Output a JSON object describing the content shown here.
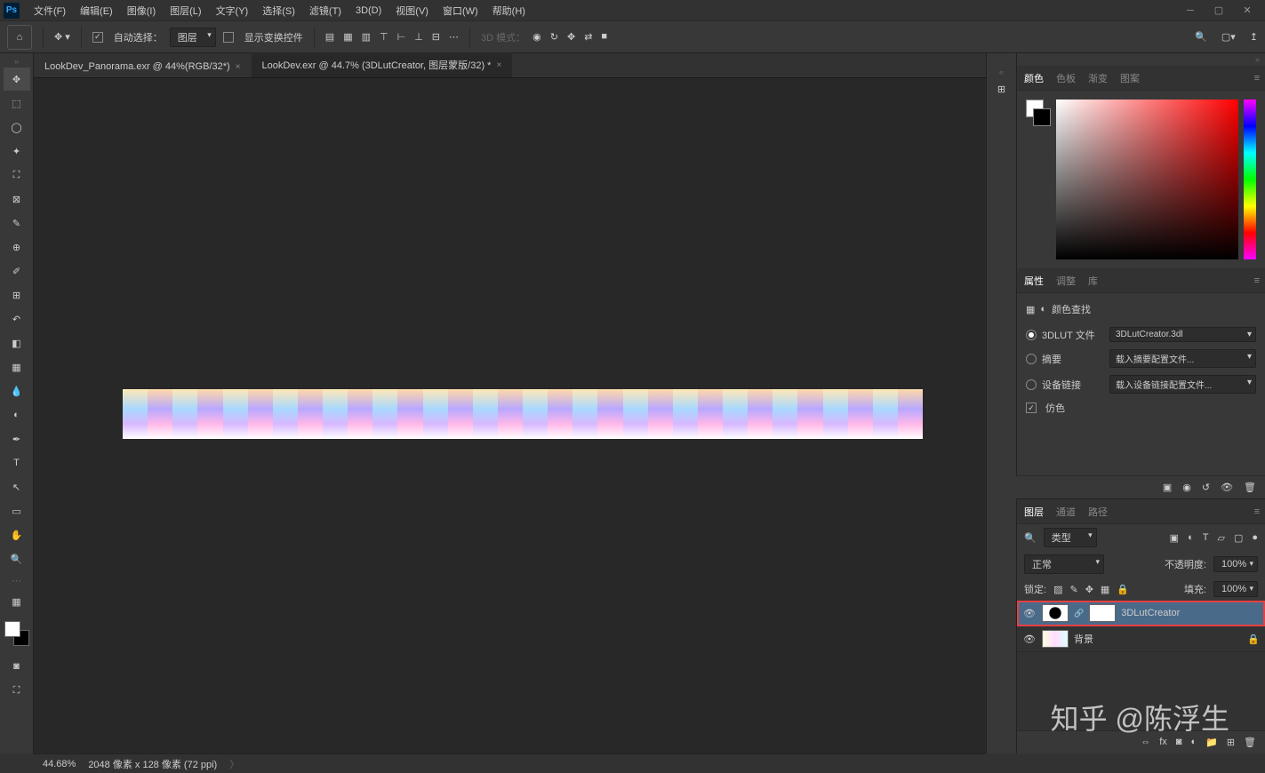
{
  "menubar": {
    "items": [
      "文件(F)",
      "编辑(E)",
      "图像(I)",
      "图层(L)",
      "文字(Y)",
      "选择(S)",
      "滤镜(T)",
      "3D(D)",
      "视图(V)",
      "窗口(W)",
      "帮助(H)"
    ]
  },
  "options": {
    "auto_select": "自动选择：",
    "layer_dd": "图层",
    "show_transform": "显示变换控件",
    "mode_3d": "3D 模式："
  },
  "tabs": [
    {
      "label": "LookDev_Panorama.exr @ 44%(RGB/32*)",
      "active": false
    },
    {
      "label": "LookDev.exr @ 44.7% (3DLutCreator, 图层蒙版/32) *",
      "active": true
    }
  ],
  "color_tabs": [
    "颜色",
    "色板",
    "渐变",
    "图案"
  ],
  "color_active": "颜色",
  "prop_tabs": [
    "属性",
    "调整",
    "库"
  ],
  "prop_active": "属性",
  "properties": {
    "title": "颜色查找",
    "lut_label": "3DLUT 文件",
    "lut_value": "3DLutCreator.3dl",
    "abstract_label": "摘要",
    "abstract_value": "载入摘要配置文件...",
    "device_label": "设备链接",
    "device_value": "载入设备链接配置文件...",
    "dither": "仿色"
  },
  "layer_tabs": [
    "图层",
    "通道",
    "路径"
  ],
  "layer_active": "图层",
  "layers": {
    "filter_type": "类型",
    "blend_mode": "正常",
    "opacity_label": "不透明度:",
    "opacity_value": "100%",
    "lock_label": "锁定:",
    "fill_label": "填充:",
    "fill_value": "100%",
    "items": [
      {
        "name": "3DLutCreator",
        "selected": true,
        "highlight": true,
        "adj": true,
        "locked": false
      },
      {
        "name": "背景",
        "selected": false,
        "highlight": false,
        "adj": false,
        "locked": true
      }
    ]
  },
  "status": {
    "zoom": "44.68%",
    "info": "2048 像素 x 128 像素 (72 ppi)"
  },
  "watermark": "知乎 @陈浮生"
}
